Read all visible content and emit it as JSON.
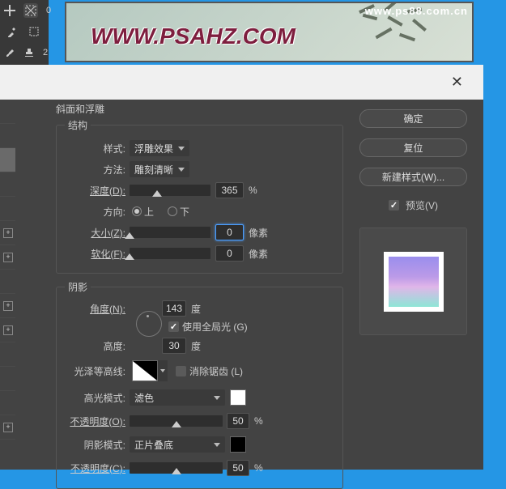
{
  "header": {
    "url": "www.ps88.com.cn",
    "title": "WWW.PSAHZ.COM"
  },
  "toolbar": {
    "num1": "0",
    "num2": "2"
  },
  "dialog": {
    "section_title": "斜面和浮雕",
    "structure": {
      "legend": "结构",
      "style_label": "样式:",
      "style_value": "浮雕效果",
      "method_label": "方法:",
      "method_value": "雕刻清晰",
      "depth_label": "深度(D):",
      "depth_value": "365",
      "depth_unit": "%",
      "direction_label": "方向:",
      "direction_up": "上",
      "direction_down": "下",
      "size_label": "大小(Z):",
      "size_value": "0",
      "size_unit": "像素",
      "soften_label": "软化(F):",
      "soften_value": "0",
      "soften_unit": "像素"
    },
    "shading": {
      "legend": "阴影",
      "angle_label": "角度(N):",
      "angle_value": "143",
      "angle_unit": "度",
      "global_light": "使用全局光 (G)",
      "altitude_label": "高度:",
      "altitude_value": "30",
      "altitude_unit": "度",
      "contour_label": "光泽等高线:",
      "antialias": "消除锯齿 (L)",
      "highlight_mode_label": "高光模式:",
      "highlight_mode_value": "滤色",
      "highlight_opacity_label": "不透明度(O):",
      "highlight_opacity_value": "50",
      "highlight_opacity_unit": "%",
      "shadow_mode_label": "阴影模式:",
      "shadow_mode_value": "正片叠底",
      "shadow_opacity_label": "不透明度(C):",
      "shadow_opacity_value": "50",
      "shadow_opacity_unit": "%"
    },
    "buttons": {
      "ok": "确定",
      "reset": "复位",
      "new_style": "新建样式(W)...",
      "preview": "预览(V)"
    }
  }
}
